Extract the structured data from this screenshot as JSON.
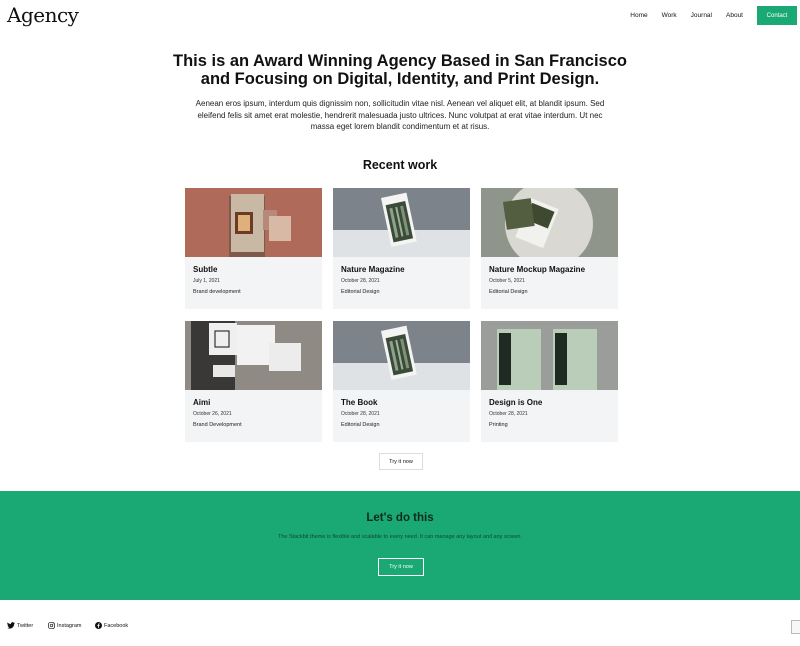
{
  "header": {
    "logo": "Agency",
    "nav": [
      "Home",
      "Work",
      "Journal",
      "About"
    ],
    "contact_label": "Contact"
  },
  "hero": {
    "title_line1": "This is an Award Winning Agency Based in San Francisco",
    "title_line2": "and Focusing on Digital, Identity, and Print Design.",
    "text": "Aenean eros ipsum, interdum quis dignissim non, sollicitudin vitae nisl. Aenean vel aliquet elit, at blandit ipsum. Sed eleifend felis sit amet erat molestie, hendrerit malesuada justo ultrices. Nunc volutpat at erat vitae interdum. Ut nec massa eget lorem blandit condimentum et at risus."
  },
  "recent": {
    "title": "Recent work",
    "cards": [
      {
        "title": "Subtle",
        "date": "July 1, 2021",
        "category": "Brand development"
      },
      {
        "title": "Nature Magazine",
        "date": "October 28, 2021",
        "category": "Editorial Design"
      },
      {
        "title": "Nature Mockup Magazine",
        "date": "October 5, 2021",
        "category": "Editorial Design"
      },
      {
        "title": "Aimi",
        "date": "October 26, 2021",
        "category": "Brand Development"
      },
      {
        "title": "The Book",
        "date": "October 28, 2021",
        "category": "Editorial Design"
      },
      {
        "title": "Design is One",
        "date": "October 28, 2021",
        "category": "Printing"
      }
    ],
    "button_label": "Try it now"
  },
  "cta": {
    "title": "Let's do this",
    "text": "The Stackbit theme is flexible and scalable to every need. It can manage any layout and any screen.",
    "button_label": "Try it now"
  },
  "footer": {
    "twitter": "Twitter",
    "instagram": "Instagram",
    "facebook": "Facebook"
  },
  "colors": {
    "accent": "#1aa874",
    "card_bg": "#f3f4f5"
  }
}
